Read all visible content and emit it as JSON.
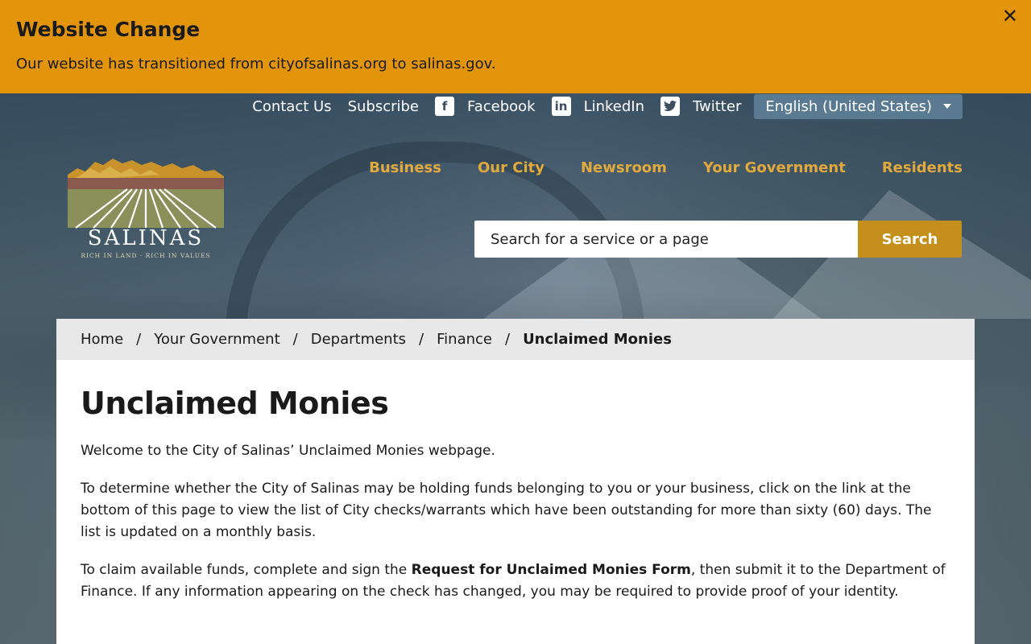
{
  "alert": {
    "title": "Website Change",
    "text": "Our website has transitioned from cityofsalinas.org to salinas.gov.",
    "close_label": "✕"
  },
  "utility_nav": {
    "contact": "Contact Us",
    "subscribe": "Subscribe",
    "facebook": "Facebook",
    "linkedin": "LinkedIn",
    "twitter": "Twitter",
    "language": "English (United States)"
  },
  "logo": {
    "word": "SALINAS",
    "tagline": "RICH IN LAND · RICH IN VALUES"
  },
  "main_nav": [
    "Business",
    "Our City",
    "Newsroom",
    "Your Government",
    "Residents"
  ],
  "search": {
    "placeholder": "Search for a service or a page",
    "button_label": "Search"
  },
  "breadcrumb": [
    "Home",
    "Your Government",
    "Departments",
    "Finance",
    "Unclaimed Monies"
  ],
  "page": {
    "title": "Unclaimed Monies",
    "p1": "Welcome to the City of Salinas’ Unclaimed Monies webpage.",
    "p2": "To determine whether the City of Salinas may be holding funds belonging to you or your business, click on the link at the bottom of this page to view the list of City checks/warrants which have been outstanding for more than sixty (60) days. The list is updated on a monthly basis.",
    "p3_before": "To claim available funds, complete and sign the ",
    "p3_link": "Request for Unclaimed Monies Form",
    "p3_after": ", then submit it to the Department of Finance. If any information appearing on the check has changed, you may be required to provide proof of your identity."
  },
  "colors": {
    "alert_bg": "#e2940b",
    "nav_gold": "#e2a93c",
    "search_button": "#c58f1c",
    "language_bg": "#597a90"
  },
  "icons": {
    "close": "close-icon",
    "facebook": "facebook-icon",
    "linkedin": "linkedin-icon",
    "twitter": "twitter-icon",
    "caret": "chevron-down-icon"
  }
}
